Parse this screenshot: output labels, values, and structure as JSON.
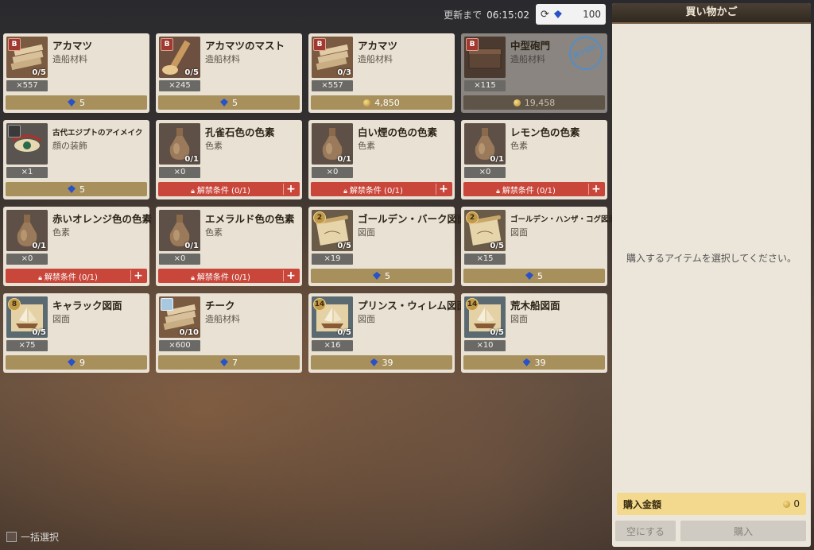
{
  "header": {
    "timer_label": "更新まで",
    "timer_value": "06:15:02",
    "gem_count": "100"
  },
  "items": [
    {
      "name": "アカマツ",
      "category": "造船材料",
      "qty": "0/5",
      "count": "×557",
      "price": "5",
      "currency": "gem",
      "state": "buy",
      "badge": "B",
      "badge_style": "sq",
      "art": "lumber",
      "small": false
    },
    {
      "name": "アカマツのマスト",
      "category": "造船材料",
      "qty": "0/5",
      "count": "×245",
      "price": "5",
      "currency": "gem",
      "state": "buy",
      "badge": "B",
      "badge_style": "sq",
      "art": "mast",
      "small": false
    },
    {
      "name": "アカマツ",
      "category": "造船材料",
      "qty": "0/3",
      "count": "×557",
      "price": "4,850",
      "currency": "coin",
      "state": "buy",
      "badge": "B",
      "badge_style": "sq",
      "art": "lumber",
      "small": false
    },
    {
      "name": "中型砲門",
      "category": "造船材料",
      "qty": "",
      "count": "×115",
      "price": "19,458",
      "currency": "coin",
      "state": "sold",
      "badge": "B",
      "badge_style": "sq",
      "art": "chest",
      "small": false,
      "stamp": "売り切れ"
    },
    {
      "name": "古代エジプトのアイメイク",
      "category": "顔の装飾",
      "qty": "",
      "count": "×1",
      "price": "5",
      "currency": "gem",
      "state": "buy",
      "badge": "",
      "badge_style": "dark",
      "art": "eye",
      "small": true
    },
    {
      "name": "孔雀石色の色素",
      "category": "色素",
      "qty": "0/1",
      "count": "×0",
      "price": "",
      "currency": "",
      "state": "locked",
      "badge": "",
      "badge_style": "",
      "art": "bottle",
      "small": false
    },
    {
      "name": "白い煙の色の色素",
      "category": "色素",
      "qty": "0/1",
      "count": "×0",
      "price": "",
      "currency": "",
      "state": "locked",
      "badge": "",
      "badge_style": "",
      "art": "bottle",
      "small": false
    },
    {
      "name": "レモン色の色素",
      "category": "色素",
      "qty": "0/1",
      "count": "×0",
      "price": "",
      "currency": "",
      "state": "locked",
      "badge": "",
      "badge_style": "",
      "art": "bottle",
      "small": false
    },
    {
      "name": "赤いオレンジ色の色素",
      "category": "色素",
      "qty": "0/1",
      "count": "×0",
      "price": "",
      "currency": "",
      "state": "locked",
      "badge": "",
      "badge_style": "",
      "art": "bottle",
      "small": false
    },
    {
      "name": "エメラルド色の色素",
      "category": "色素",
      "qty": "0/1",
      "count": "×0",
      "price": "",
      "currency": "",
      "state": "locked",
      "badge": "",
      "badge_style": "",
      "art": "bottle",
      "small": false
    },
    {
      "name": "ゴールデン・バーク図面",
      "category": "図面",
      "qty": "0/5",
      "count": "×19",
      "price": "5",
      "currency": "gem",
      "state": "buy",
      "badge": "2",
      "badge_style": "",
      "art": "scroll",
      "small": false
    },
    {
      "name": "ゴールデン・ハンザ・コグ図面",
      "category": "図面",
      "qty": "0/5",
      "count": "×15",
      "price": "5",
      "currency": "gem",
      "state": "buy",
      "badge": "2",
      "badge_style": "",
      "art": "scroll",
      "small": true
    },
    {
      "name": "キャラック図面",
      "category": "図面",
      "qty": "0/5",
      "count": "×75",
      "price": "9",
      "currency": "gem",
      "state": "buy",
      "badge": "8",
      "badge_style": "",
      "art": "ship",
      "small": false
    },
    {
      "name": "チーク",
      "category": "造船材料",
      "qty": "0/10",
      "count": "×600",
      "price": "7",
      "currency": "gem",
      "state": "buy",
      "badge": "",
      "badge_style": "ice",
      "art": "lumber",
      "small": false
    },
    {
      "name": "プリンス・ウィレム図面",
      "category": "図面",
      "qty": "0/5",
      "count": "×16",
      "price": "39",
      "currency": "gem",
      "state": "buy",
      "badge": "14",
      "badge_style": "",
      "art": "ship",
      "small": false
    },
    {
      "name": "荒木船図面",
      "category": "図面",
      "qty": "0/5",
      "count": "×10",
      "price": "39",
      "currency": "gem",
      "state": "buy",
      "badge": "14",
      "badge_style": "",
      "art": "ship",
      "small": false
    }
  ],
  "locked_label": "解禁条件 (0/1)",
  "bulk_select_label": "一括選択",
  "cart": {
    "title": "買い物かご",
    "empty_message": "購入するアイテムを選択してください。",
    "total_label": "購入金額",
    "total_value": "0",
    "clear_label": "空にする",
    "buy_label": "購入"
  }
}
